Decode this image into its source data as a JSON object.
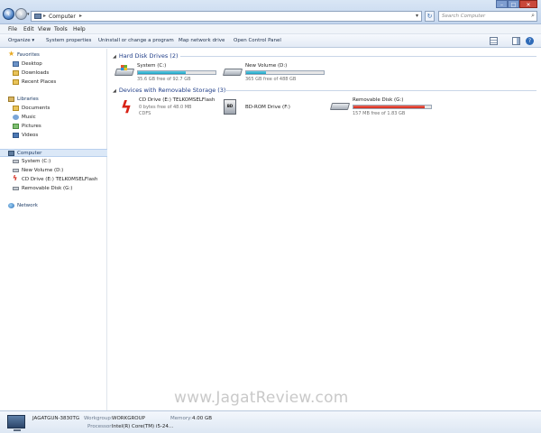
{
  "address": {
    "crumb": "Computer"
  },
  "search": {
    "placeholder": "Search Computer"
  },
  "menu": [
    "File",
    "Edit",
    "View",
    "Tools",
    "Help"
  ],
  "toolbar": {
    "organize": "Organize ▾",
    "system_properties": "System properties",
    "uninstall": "Uninstall or change a program",
    "map_drive": "Map network drive",
    "control_panel": "Open Control Panel"
  },
  "nav": {
    "favorites": "Favorites",
    "desktop": "Desktop",
    "downloads": "Downloads",
    "recent": "Recent Places",
    "libraries": "Libraries",
    "documents": "Documents",
    "music": "Music",
    "pictures": "Pictures",
    "videos": "Videos",
    "computer": "Computer",
    "system_c": "System (C:)",
    "new_volume_d": "New Volume (D:)",
    "cd_drive": "CD Drive (E:) TELKOMSELFlash",
    "removable_g": "Removable Disk (G:)",
    "network": "Network"
  },
  "hdd_group": {
    "title": "Hard Disk Drives (2)"
  },
  "removable_group": {
    "title": "Devices with Removable Storage (3)"
  },
  "drives": {
    "c": {
      "name": "System (C:)",
      "free": "35.6 GB free of 92.7 GB",
      "used_fraction": 0.62
    },
    "d": {
      "name": "New Volume (D:)",
      "free": "365 GB free of 488 GB",
      "used_fraction": 0.25
    },
    "e": {
      "name": "CD Drive (E:) TELKOMSELFlash",
      "free": "0 bytes free of 48.0 MB",
      "fs": "CDFS"
    },
    "f": {
      "name": "BD-ROM Drive (F:)",
      "icon_text": "BD"
    },
    "g": {
      "name": "Removable Disk (G:)",
      "free": "157 MB free of 1.83 GB",
      "used_fraction": 0.92
    }
  },
  "details": {
    "computer_name": "JAGATGUN-3830TG",
    "workgroup_label": "Workgroup:",
    "workgroup": "WORKGROUP",
    "memory_label": "Memory:",
    "memory": "4.00 GB",
    "processor_label": "Processor:",
    "processor": "Intel(R) Core(TM) i5-24..."
  },
  "watermark": "www.JagatReview.com",
  "colors": {
    "bar_normal": "#26a9c9",
    "bar_full": "#d8261a",
    "group_header": "#1e3c87"
  }
}
